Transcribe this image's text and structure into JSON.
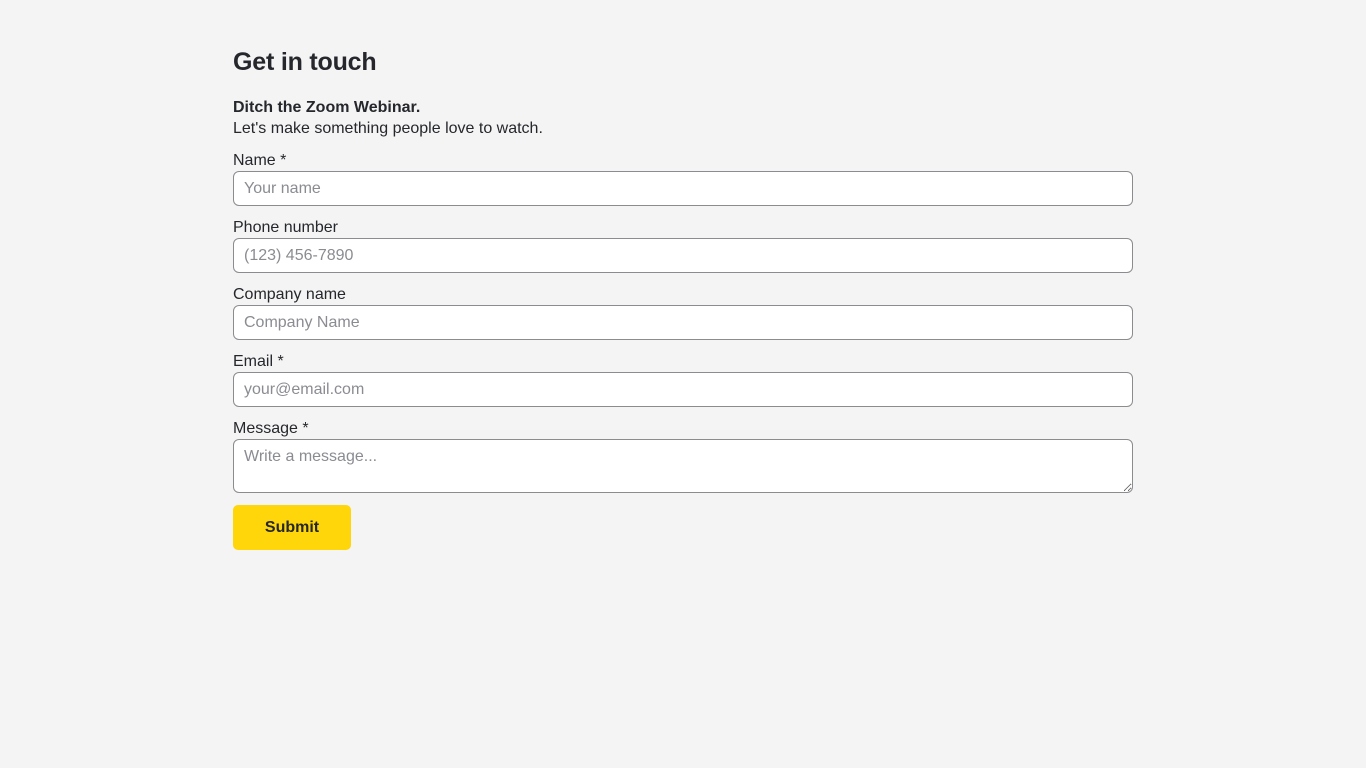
{
  "page": {
    "title": "Get in touch",
    "intro_lead": "Ditch the Zoom Webinar.",
    "intro_sub": "Let's make something people love to watch."
  },
  "form": {
    "name": {
      "label": "Name *",
      "placeholder": "Your name",
      "value": ""
    },
    "phone": {
      "label": "Phone number",
      "placeholder": "(123) 456-7890",
      "value": ""
    },
    "company": {
      "label": "Company name",
      "placeholder": "Company Name",
      "value": ""
    },
    "email": {
      "label": "Email *",
      "placeholder": "your@email.com",
      "value": ""
    },
    "message": {
      "label": "Message *",
      "placeholder": "Write a message...",
      "value": ""
    },
    "submit_label": "Submit"
  },
  "colors": {
    "background": "#f4f4f4",
    "text": "#25272c",
    "accent": "#ffd60a",
    "input_border": "#8a8c90"
  }
}
